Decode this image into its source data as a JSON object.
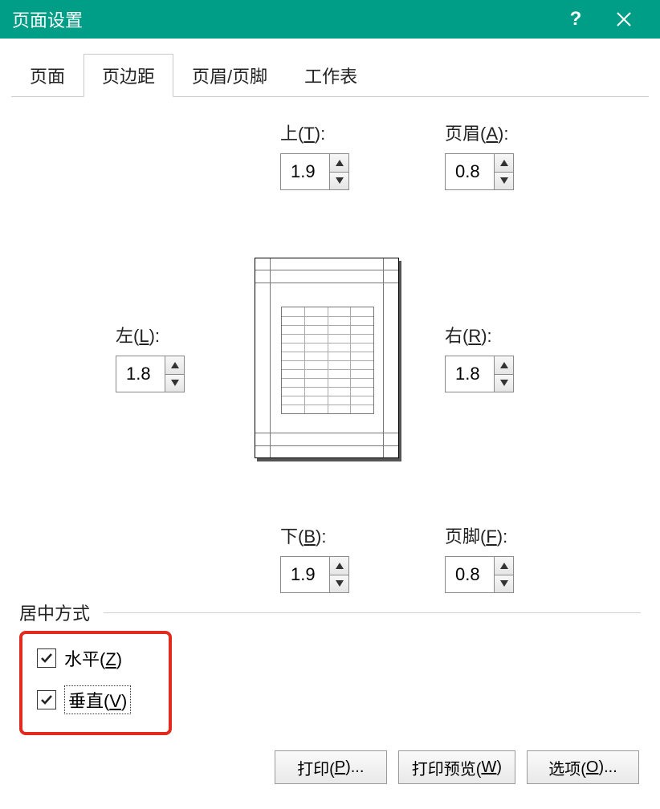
{
  "titlebar": {
    "title": "页面设置",
    "help_symbol": "?",
    "close_symbol": "×"
  },
  "tabs": {
    "page": "页面",
    "margins": "页边距",
    "header_footer": "页眉/页脚",
    "sheet": "工作表"
  },
  "fields": {
    "top": {
      "label_pre": "上(",
      "key": "T",
      "label_post": "):",
      "value": "1.9"
    },
    "header": {
      "label_pre": "页眉(",
      "key": "A",
      "label_post": "):",
      "value": "0.8"
    },
    "left": {
      "label_pre": "左(",
      "key": "L",
      "label_post": "):",
      "value": "1.8"
    },
    "right": {
      "label_pre": "右(",
      "key": "R",
      "label_post": "):",
      "value": "1.8"
    },
    "bottom": {
      "label_pre": "下(",
      "key": "B",
      "label_post": "):",
      "value": "1.9"
    },
    "footer": {
      "label_pre": "页脚(",
      "key": "F",
      "label_post": "):",
      "value": "0.8"
    }
  },
  "center": {
    "legend": "居中方式",
    "horizontal_pre": "水平(",
    "horizontal_key": "Z",
    "horizontal_post": ")",
    "vertical_pre": "垂直(",
    "vertical_key": "V",
    "vertical_post": ")",
    "horizontal_checked": true,
    "vertical_checked": true
  },
  "buttons": {
    "print_pre": "打印(",
    "print_key": "P",
    "print_post": ")...",
    "preview_pre": "打印预览(",
    "preview_key": "W",
    "preview_post": ")",
    "options_pre": "选项(",
    "options_key": "O",
    "options_post": ")..."
  },
  "colors": {
    "accent": "#009e86",
    "highlight": "#e22a1e"
  }
}
